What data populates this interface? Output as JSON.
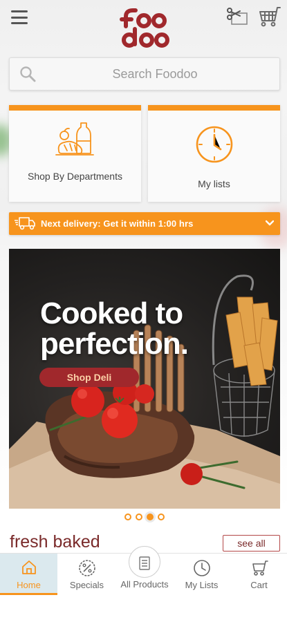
{
  "header": {
    "menu_icon": "hamburger-icon",
    "logo_text": "foo doo",
    "scan_icon": "scan-icon",
    "cart_icon": "cart-icon"
  },
  "search": {
    "placeholder": "Search Foodoo",
    "value": "",
    "icon": "search-icon"
  },
  "tiles": [
    {
      "label": "Shop By Departments",
      "icon": "groceries-icon"
    },
    {
      "label": "My lists",
      "icon": "clock-icon"
    }
  ],
  "delivery": {
    "text": "Next delivery: Get it within 1:00 hrs",
    "icon": "truck-icon",
    "chevron": "chevron-down-icon"
  },
  "banner": {
    "headline_line1": "Cooked to",
    "headline_line2": "perfection.",
    "cta": "Shop Deli"
  },
  "carousel": {
    "count": 4,
    "active_index": 2
  },
  "section": {
    "title": "fresh baked",
    "see_all": "see all"
  },
  "bottom_nav": {
    "items": [
      {
        "label": "Home",
        "icon": "home-icon",
        "active": true
      },
      {
        "label": "Specials",
        "icon": "percent-tag-icon",
        "active": false
      },
      {
        "label": "All Products",
        "icon": "list-icon",
        "active": false
      },
      {
        "label": "My Lists",
        "icon": "clock-icon",
        "active": false
      },
      {
        "label": "Cart",
        "icon": "cart-icon",
        "active": false
      }
    ]
  },
  "colors": {
    "accent": "#f7941d",
    "brand": "#a0282c",
    "section_text": "#7a2a2a"
  }
}
